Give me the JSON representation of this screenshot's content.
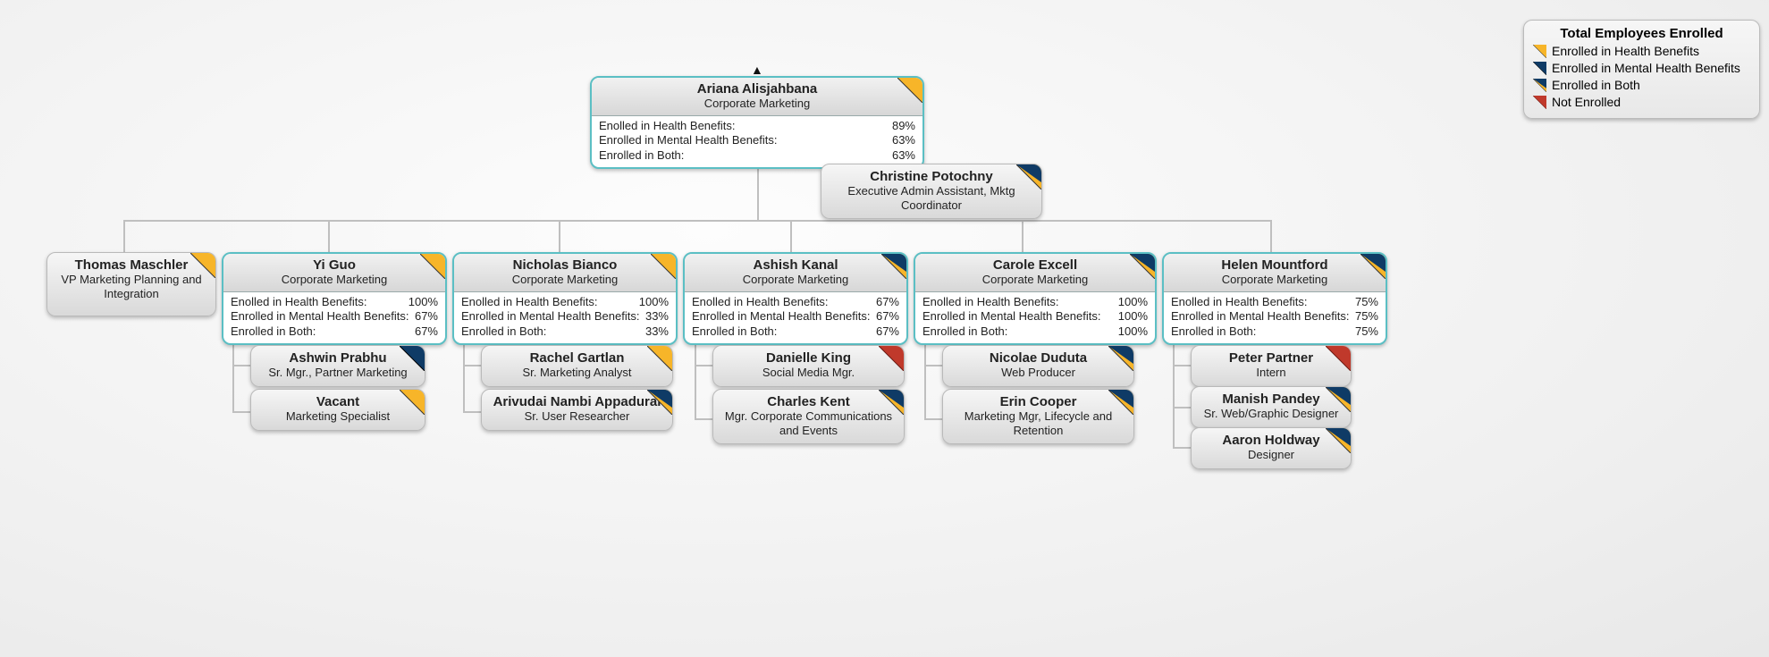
{
  "colors": {
    "health": "#f7b529",
    "mental": "#0f3b66",
    "notenrolled": "#c0392b"
  },
  "legend": {
    "title": "Total Employees Enrolled",
    "items": [
      {
        "label": "Enrolled in Health Benefits",
        "type": "health"
      },
      {
        "label": "Enrolled in Mental Health Benefits",
        "type": "mental"
      },
      {
        "label": "Enrolled in Both",
        "type": "both"
      },
      {
        "label": "Not Enrolled",
        "type": "notenrolled"
      }
    ]
  },
  "stat_labels": {
    "health": "Enolled in Health Benefits:",
    "mental": "Enrolled in Mental Health Benefits:",
    "both": "Enrolled in Both:"
  },
  "root": {
    "name": "Ariana Alisjahbana",
    "subtitle": "Corporate Marketing",
    "tag": "health",
    "stats": {
      "health": "89%",
      "mental": "63%",
      "both": "63%"
    }
  },
  "assistant": {
    "name": "Christine Potochny",
    "subtitle": "Executive Admin Assistant, Mktg Coordinator",
    "tag": "both"
  },
  "branches": [
    {
      "type": "emp",
      "name": "Thomas Maschler",
      "subtitle": "VP Marketing Planning and Integration",
      "tag": "health",
      "children": []
    },
    {
      "type": "mgr",
      "name": "Yi Guo",
      "subtitle": "Corporate Marketing",
      "tag": "health",
      "stats": {
        "health": "100%",
        "mental": "67%",
        "both": "67%"
      },
      "children": [
        {
          "name": "Ashwin Prabhu",
          "subtitle": "Sr. Mgr., Partner Marketing",
          "tag": "mental"
        },
        {
          "name": "Vacant",
          "subtitle": "Marketing Specialist",
          "tag": "health"
        }
      ]
    },
    {
      "type": "mgr",
      "name": "Nicholas Bianco",
      "subtitle": "Corporate Marketing",
      "tag": "health",
      "stats": {
        "health": "100%",
        "mental": "33%",
        "both": "33%"
      },
      "children": [
        {
          "name": "Rachel Gartlan",
          "subtitle": "Sr. Marketing Analyst",
          "tag": "health"
        },
        {
          "name": "Arivudai Nambi Appadurai",
          "subtitle": "Sr. User Researcher",
          "tag": "both"
        }
      ]
    },
    {
      "type": "mgr",
      "name": "Ashish Kanal",
      "subtitle": "Corporate Marketing",
      "tag": "both",
      "stats": {
        "health": "67%",
        "mental": "67%",
        "both": "67%"
      },
      "children": [
        {
          "name": "Danielle King",
          "subtitle": "Social Media Mgr.",
          "tag": "notenrolled"
        },
        {
          "name": "Charles Kent",
          "subtitle": "Mgr. Corporate Communications and Events",
          "tag": "both"
        }
      ]
    },
    {
      "type": "mgr",
      "name": "Carole Excell",
      "subtitle": "Corporate Marketing",
      "tag": "both",
      "stats": {
        "health": "100%",
        "mental": "100%",
        "both": "100%"
      },
      "children": [
        {
          "name": "Nicolae Duduta",
          "subtitle": "Web Producer",
          "tag": "both"
        },
        {
          "name": "Erin Cooper",
          "subtitle": "Marketing Mgr, Lifecycle and Retention",
          "tag": "both"
        }
      ]
    },
    {
      "type": "mgr",
      "name": "Helen Mountford",
      "subtitle": "Corporate Marketing",
      "tag": "both",
      "stats": {
        "health": "75%",
        "mental": "75%",
        "both": "75%"
      },
      "children": [
        {
          "name": "Peter Partner",
          "subtitle": "Intern",
          "tag": "notenrolled"
        },
        {
          "name": "Manish Pandey",
          "subtitle": "Sr. Web/Graphic Designer",
          "tag": "both"
        },
        {
          "name": "Aaron Holdway",
          "subtitle": "Designer",
          "tag": "both"
        }
      ]
    }
  ]
}
